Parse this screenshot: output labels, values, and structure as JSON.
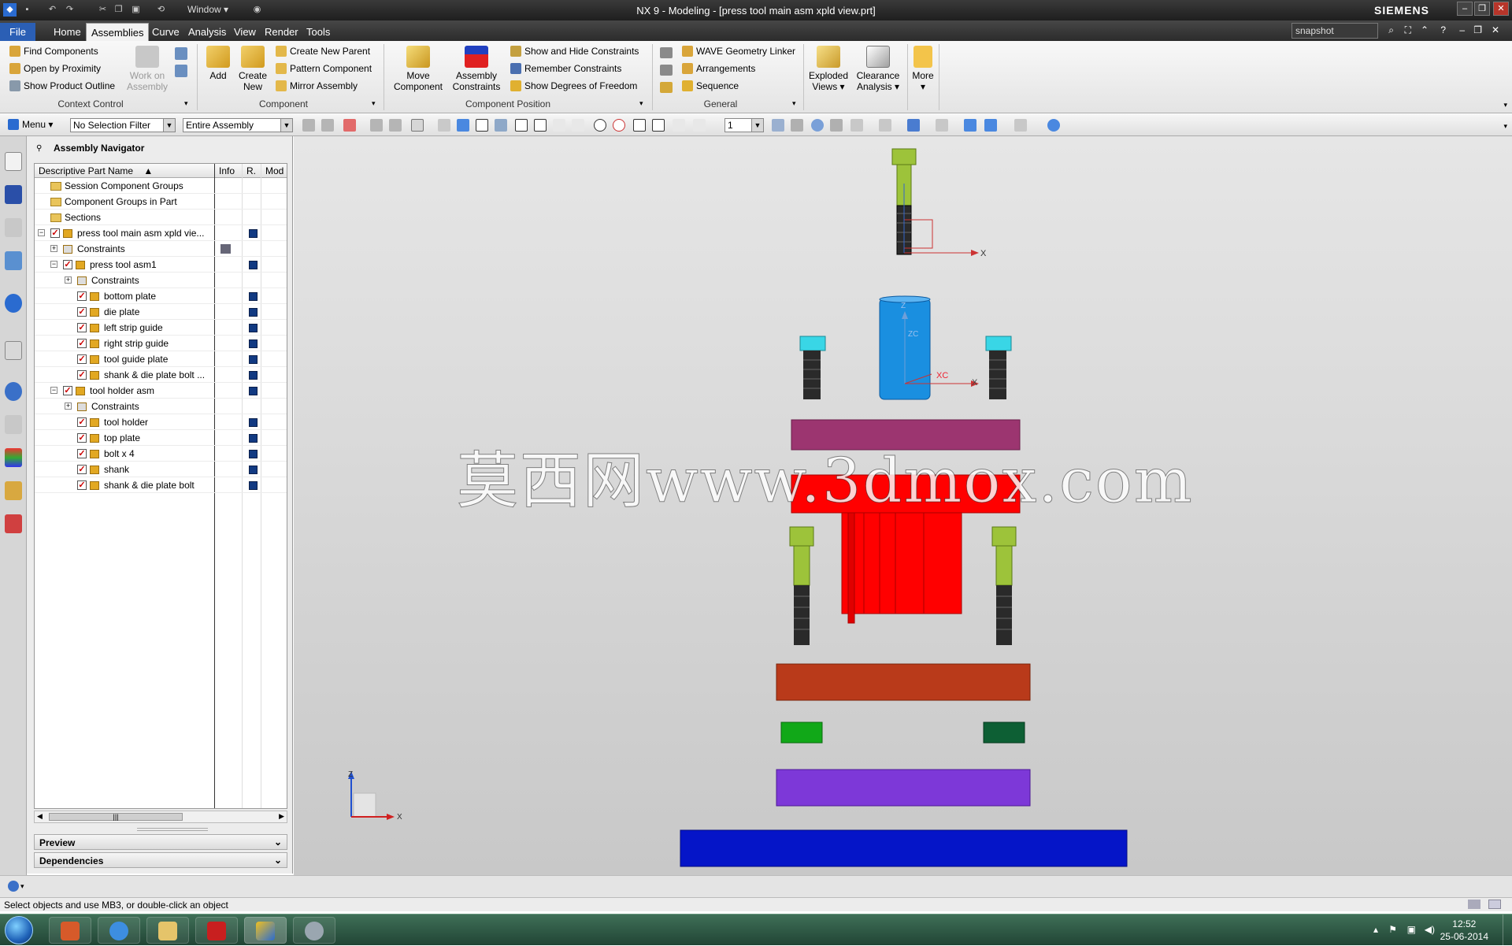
{
  "window": {
    "title": "NX 9 - Modeling - [press tool main asm xpld view.prt]",
    "brand": "SIEMENS",
    "quick_window_label": "Window"
  },
  "menubar": {
    "tabs": [
      "File",
      "Home",
      "Assemblies",
      "Curve",
      "Analysis",
      "View",
      "Render",
      "Tools"
    ],
    "active_tab": "Assemblies",
    "search_value": "snapshot"
  },
  "ribbon": {
    "context_control": {
      "items": [
        "Find Components",
        "Open by Proximity",
        "Show Product Outline"
      ],
      "work_on_assembly": "Work on Assembly",
      "label": "Context Control"
    },
    "component": {
      "add": "Add",
      "create_new": "Create New",
      "items": [
        "Create New Parent",
        "Pattern Component",
        "Mirror Assembly"
      ],
      "label": "Component"
    },
    "component_position": {
      "move_component": "Move Component",
      "assembly_constraints": "Assembly Constraints",
      "items": [
        "Show and Hide Constraints",
        "Remember Constraints",
        "Show Degrees of Freedom"
      ],
      "label": "Component Position"
    },
    "general": {
      "items": [
        "WAVE Geometry Linker",
        "Arrangements",
        "Sequence"
      ],
      "label": "General"
    },
    "exploded_views": "Exploded Views",
    "clearance_analysis": "Clearance Analysis",
    "more": "More"
  },
  "toolbar": {
    "menu_label": "Menu",
    "selection_filter": "No Selection Filter",
    "scope": "Entire Assembly",
    "layer_value": "1"
  },
  "navigator": {
    "title": "Assembly Navigator",
    "columns": [
      "Descriptive Part Name",
      "Info",
      "R.",
      "Mod"
    ],
    "rows": [
      {
        "label": "Session Component Groups"
      },
      {
        "label": "Component Groups in Part"
      },
      {
        "label": "Sections"
      },
      {
        "label": "press tool main asm xpld vie..."
      },
      {
        "label": "Constraints"
      },
      {
        "label": "press tool asm1"
      },
      {
        "label": "Constraints"
      },
      {
        "label": "bottom plate"
      },
      {
        "label": "die plate"
      },
      {
        "label": "left strip guide"
      },
      {
        "label": "right strip guide"
      },
      {
        "label": "tool guide plate"
      },
      {
        "label": "shank & die plate bolt ..."
      },
      {
        "label": "tool holder asm"
      },
      {
        "label": "Constraints"
      },
      {
        "label": "tool holder"
      },
      {
        "label": "top plate"
      },
      {
        "label": "bolt x 4"
      },
      {
        "label": "shank"
      },
      {
        "label": "shank & die plate bolt"
      }
    ],
    "preview_label": "Preview",
    "dependencies_label": "Dependencies"
  },
  "viewport": {
    "watermark": "莫西网www.3dmox.com",
    "axis_labels": {
      "x": "X",
      "z": "Z",
      "xc": "XC",
      "zc": "ZC"
    }
  },
  "status": {
    "message": "Select objects and use MB3, or double-click an object"
  },
  "taskbar": {
    "time": "12:52",
    "date": "25-06-2014"
  },
  "colors": {
    "top_bolt": "#9dc33a",
    "bolt_head_cyan": "#39d6e6",
    "shank_blue": "#1a8fe0",
    "top_plate_magenta": "#9c3570",
    "tool_holder_red": "#ff0000",
    "guide_plate_orange": "#b93a1a",
    "strip_guide_green": "#11a818",
    "strip_guide_darkgreen": "#0d5f34",
    "die_plate_purple": "#7d38d8",
    "bottom_plate_blue": "#0515c8"
  }
}
